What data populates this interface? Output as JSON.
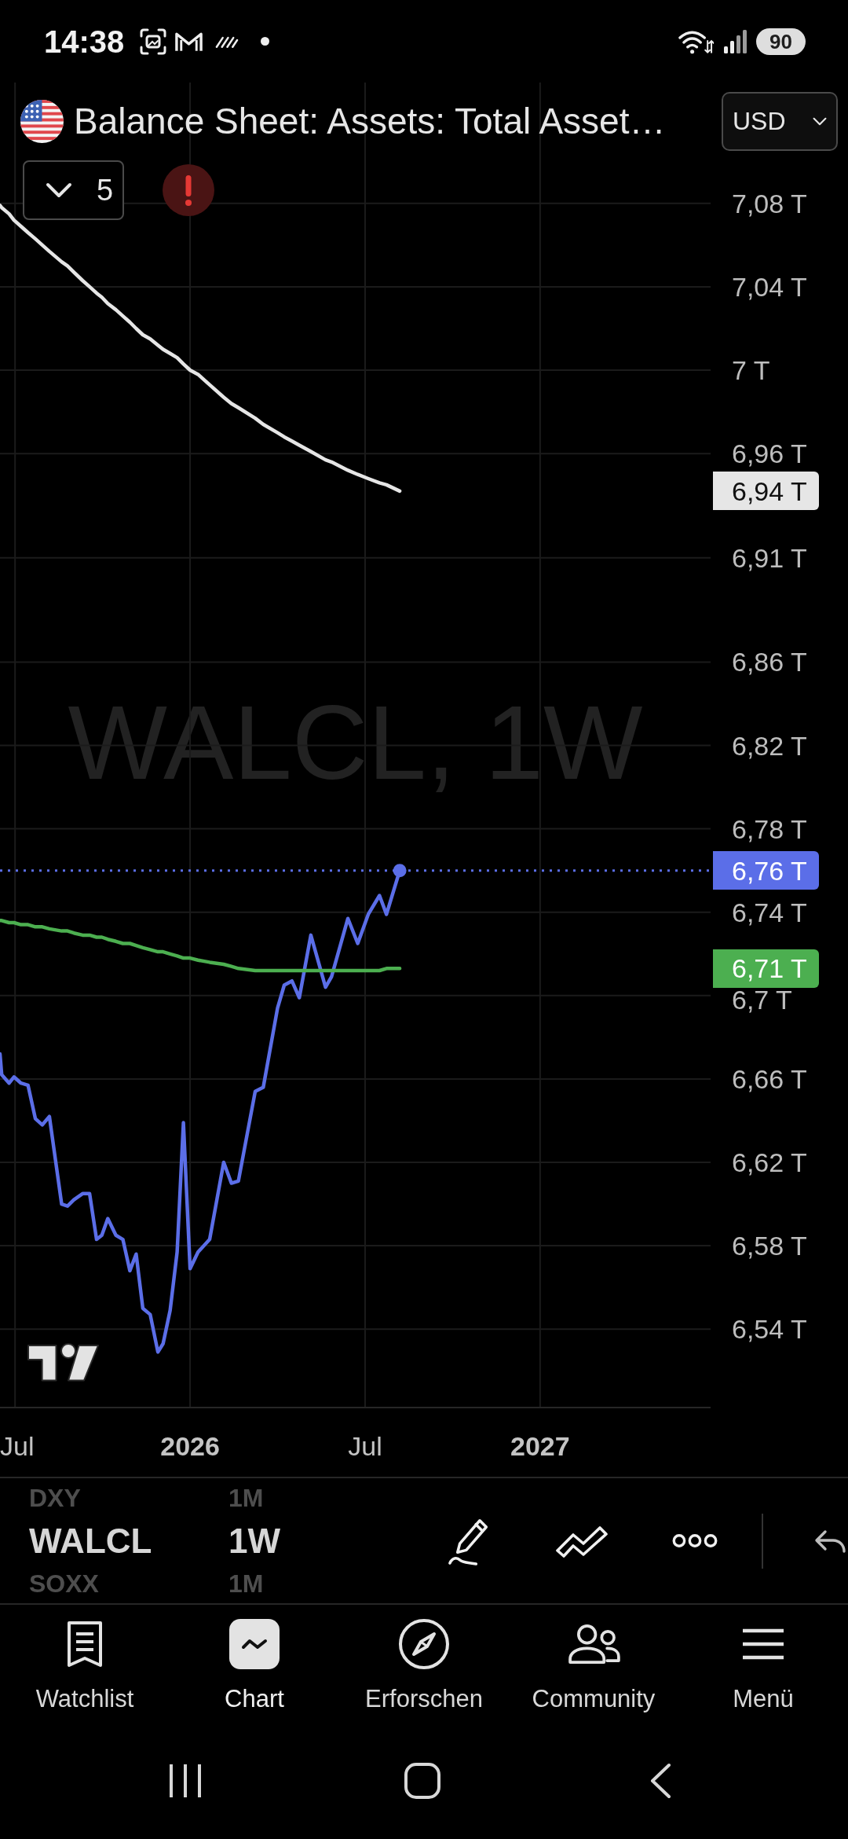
{
  "status_bar": {
    "time": "14:38",
    "battery": "90"
  },
  "header": {
    "title": "Balance Sheet: Assets: Total Asset…",
    "currency": "USD",
    "indicator_count": "5"
  },
  "chart": {
    "watermark": "WALCL, 1W",
    "chart_data": {
      "type": "line",
      "x": [
        2025.457,
        2025.462,
        2025.483,
        2025.497,
        2025.517,
        2025.537,
        2025.558,
        2025.578,
        2025.598,
        2025.633,
        2025.65,
        2025.668,
        2025.693,
        2025.713,
        2025.733,
        2025.748,
        2025.765,
        2025.788,
        2025.808,
        2025.828,
        2025.846,
        2025.865,
        2025.886,
        2025.908,
        2025.923,
        2025.943,
        2025.963,
        2025.981,
        2026.0,
        2026.023,
        2026.056,
        2026.096,
        2026.118,
        2026.138,
        2026.186,
        2026.209,
        2026.25,
        2026.269,
        2026.291,
        2026.312,
        2026.345,
        2026.387,
        2026.404,
        2026.451,
        2026.479,
        2026.509,
        2026.541,
        2026.561,
        2026.599
      ],
      "series": [
        {
          "color": "#e6e6e6",
          "values": [
            7.079,
            7.078,
            7.075,
            7.072,
            7.069,
            7.066,
            7.063,
            7.06,
            7.057,
            7.052,
            7.05,
            7.047,
            7.043,
            7.04,
            7.037,
            7.035,
            7.032,
            7.029,
            7.026,
            7.023,
            7.02,
            7.017,
            7.015,
            7.012,
            7.01,
            7.008,
            7.006,
            7.003,
            7.0,
            6.998,
            6.993,
            6.987,
            6.984,
            6.982,
            6.977,
            6.974,
            6.97,
            6.968,
            6.966,
            6.964,
            6.961,
            6.957,
            6.956,
            6.952,
            6.95,
            6.948,
            6.946,
            6.945,
            6.942
          ]
        },
        {
          "color": "#5b6ee8",
          "values": [
            6.672,
            6.662,
            6.658,
            6.661,
            6.658,
            6.657,
            6.641,
            6.638,
            6.642,
            6.6,
            6.599,
            6.602,
            6.605,
            6.605,
            6.583,
            6.585,
            6.593,
            6.585,
            6.583,
            6.568,
            6.576,
            6.55,
            6.547,
            6.529,
            6.533,
            6.549,
            6.577,
            6.639,
            6.569,
            6.577,
            6.583,
            6.62,
            6.61,
            6.611,
            6.654,
            6.656,
            6.694,
            6.705,
            6.707,
            6.699,
            6.729,
            6.704,
            6.709,
            6.737,
            6.725,
            6.739,
            6.748,
            6.739,
            6.76
          ]
        },
        {
          "color": "#4caf50",
          "values": [
            6.736,
            6.736,
            6.735,
            6.735,
            6.734,
            6.734,
            6.733,
            6.733,
            6.732,
            6.731,
            6.731,
            6.73,
            6.729,
            6.729,
            6.728,
            6.728,
            6.727,
            6.726,
            6.725,
            6.725,
            6.724,
            6.723,
            6.722,
            6.721,
            6.721,
            6.72,
            6.719,
            6.718,
            6.718,
            6.717,
            6.716,
            6.715,
            6.714,
            6.713,
            6.712,
            6.712,
            6.712,
            6.712,
            6.712,
            6.712,
            6.712,
            6.712,
            6.712,
            6.712,
            6.712,
            6.712,
            6.712,
            6.713,
            6.713
          ]
        }
      ],
      "xlim": [
        2025.457,
        2027.487
      ],
      "ylim": [
        6.502,
        7.138
      ],
      "grid": true,
      "xticks": [
        {
          "value": 2025.5,
          "label": "Jul"
        },
        {
          "value": 2026,
          "label": "2026"
        },
        {
          "value": 2026.5,
          "label": "Jul"
        },
        {
          "value": 2027,
          "label": "2027"
        }
      ],
      "yticks": [
        {
          "value": 7.08,
          "label": "7,08 T"
        },
        {
          "value": 7.04,
          "label": "7,04 T"
        },
        {
          "value": 7.0,
          "label": "7 T"
        },
        {
          "value": 6.96,
          "label": "6,96 T"
        },
        {
          "value": 6.91,
          "label": "6,91 T"
        },
        {
          "value": 6.86,
          "label": "6,86 T"
        },
        {
          "value": 6.82,
          "label": "6,82 T"
        },
        {
          "value": 6.78,
          "label": "6,78 T"
        },
        {
          "value": 6.74,
          "label": "6,74 T"
        },
        {
          "value": 6.7,
          "label": "6,7 T"
        },
        {
          "value": 6.66,
          "label": "6,66 T"
        },
        {
          "value": 6.62,
          "label": "6,62 T"
        },
        {
          "value": 6.58,
          "label": "6,58 T"
        },
        {
          "value": 6.54,
          "label": "6,54 T"
        }
      ],
      "ref_lines": [
        {
          "axis": "y",
          "value": 6.76,
          "color": "#5b6ee8"
        }
      ],
      "annotations": [
        "6,94 T",
        "6,76 T",
        "6,71 T"
      ]
    }
  },
  "symbol_bar": {
    "symbols": [
      {
        "symbol": "DXY",
        "interval": "1M",
        "selected": false
      },
      {
        "symbol": "WALCL",
        "interval": "1W",
        "selected": true
      },
      {
        "symbol": "SOXX",
        "interval": "1M",
        "selected": false
      }
    ]
  },
  "nav": {
    "items": [
      {
        "label": "Watchlist",
        "selected": false
      },
      {
        "label": "Chart",
        "selected": true
      },
      {
        "label": "Erforschen",
        "selected": false
      },
      {
        "label": "Community",
        "selected": false
      },
      {
        "label": "Menü",
        "selected": false
      }
    ]
  }
}
